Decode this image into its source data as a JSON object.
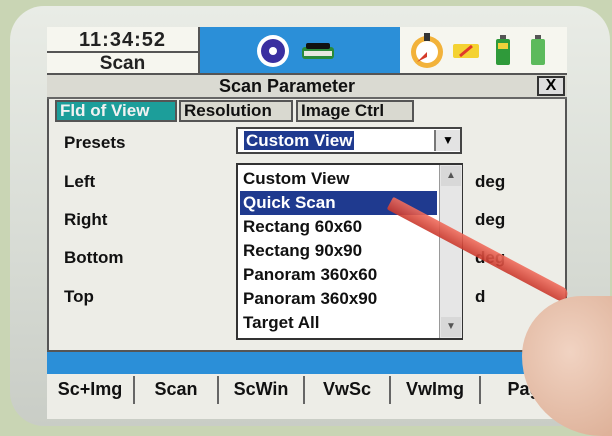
{
  "header": {
    "time": "11:34:52",
    "mode": "Scan",
    "colors": {
      "blue_bar": "#2b8fd8",
      "active_tab": "#1c9e9a",
      "selection": "#1f3a8f"
    },
    "icons": [
      "disc-icon",
      "device-icon",
      "compass-icon",
      "battery-low-icon",
      "battery-icon",
      "battery-icon-2"
    ]
  },
  "dialog": {
    "title": "Scan Parameter",
    "close_label": "X",
    "tabs": [
      "Fld of View",
      "Resolution",
      "Image Ctrl"
    ],
    "active_tab": "Fld of View"
  },
  "form": {
    "presets_label": "Presets",
    "preset_selected": "Custom View",
    "fields": [
      "Left",
      "Right",
      "Bottom",
      "Top"
    ],
    "units": [
      "deg",
      "deg",
      "deg",
      "d"
    ]
  },
  "dropdown": {
    "options": [
      "Custom View",
      "Quick Scan",
      "Rectang 60x60",
      "Rectang 90x90",
      "Panoram 360x60",
      "Panoram 360x90",
      "Target All"
    ],
    "highlighted": "Quick Scan"
  },
  "bottom_menu": [
    "Sc+Img",
    "Scan",
    "ScWin",
    "VwSc",
    "VwImg",
    "Pag"
  ]
}
